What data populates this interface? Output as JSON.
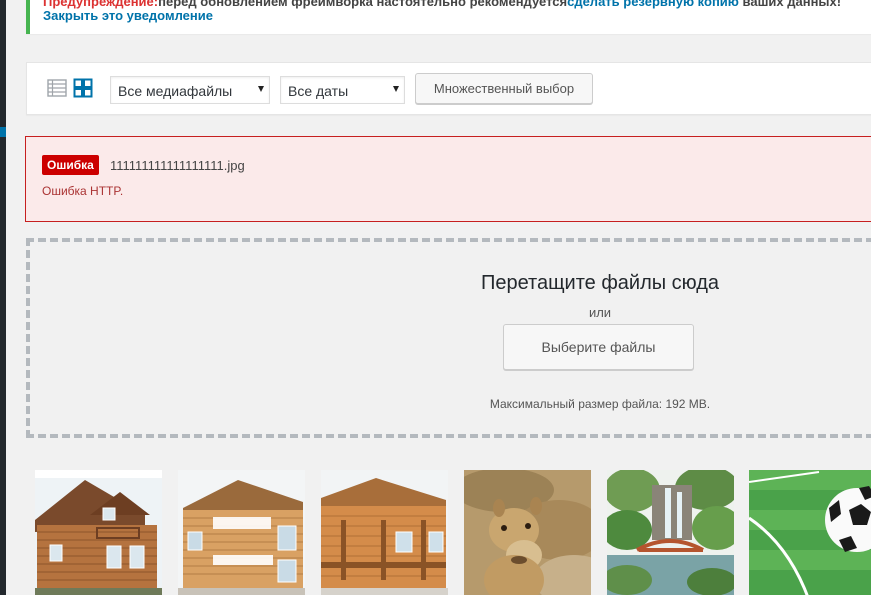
{
  "notice": {
    "warning_label": "Предупреждение:",
    "warning_text": "перед обновлением фреймворка настоятельно рекомендуется",
    "warning_link": "сделать резервную копию",
    "warning_tail": "ваших данных!",
    "dismiss_link": "Закрыть это уведомление"
  },
  "toolbar": {
    "view_list_icon": "list-view-icon",
    "view_grid_icon": "grid-view-icon",
    "media_filter": {
      "selected": "Все медиафайлы"
    },
    "date_filter": {
      "selected": "Все даты"
    },
    "bulk_select_label": "Множественный выбор"
  },
  "upload_error": {
    "badge": "Ошибка",
    "filename": "111111111111111111.jpg",
    "message": "Ошибка HTTP."
  },
  "dropzone": {
    "title": "Перетащите файлы сюда",
    "or": "или",
    "select_button": "Выберите файлы",
    "max_size": "Максимальный размер файла: 192 MB."
  },
  "attachments": [
    {
      "name": "log-house-1"
    },
    {
      "name": "log-house-2"
    },
    {
      "name": "log-house-3"
    },
    {
      "name": "camel"
    },
    {
      "name": "waterfall-garden"
    },
    {
      "name": "soccer-ball"
    }
  ],
  "colors": {
    "admin_blue": "#0073aa",
    "error_red": "#c00",
    "notice_green": "#46b450"
  }
}
